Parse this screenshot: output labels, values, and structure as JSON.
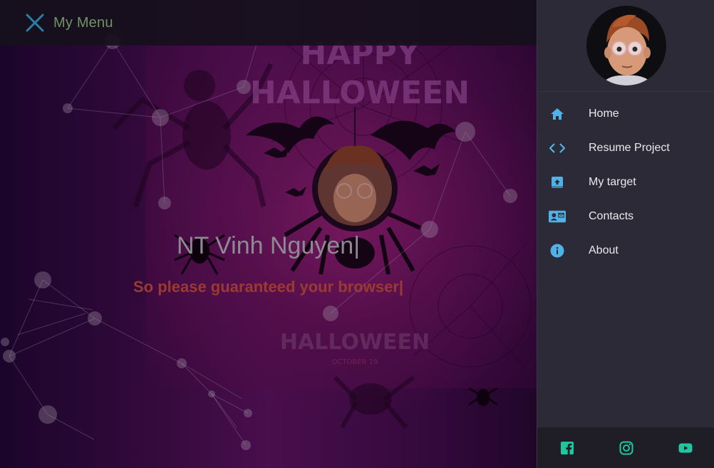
{
  "topbar": {
    "menu_title": "My Menu",
    "close_icon": "close-icon"
  },
  "hero": {
    "name": "NT Vinh Nguyen|",
    "subtitle": "So please guaranteed your browser|",
    "poster": {
      "line1": "HAPPY",
      "line2": "HALLOWEEN",
      "line3": "HALLOWEEN",
      "line4": "OCTOBER 19"
    }
  },
  "sidebar": {
    "items": [
      {
        "label": "Home",
        "icon": "home-icon"
      },
      {
        "label": "Resume Project",
        "icon": "code-icon"
      },
      {
        "label": "My target",
        "icon": "inbox-icon"
      },
      {
        "label": "Contacts",
        "icon": "contact-card-icon"
      },
      {
        "label": "About",
        "icon": "info-icon"
      }
    ],
    "social": [
      {
        "icon": "facebook-icon"
      },
      {
        "icon": "instagram-icon"
      },
      {
        "icon": "youtube-icon"
      }
    ]
  },
  "colors": {
    "accent_teal": "#1fc7a0",
    "nav_icon_blue": "#4fb3e8",
    "sidebar_bg": "#2c2a37",
    "subtitle_red": "#9a3a33"
  }
}
